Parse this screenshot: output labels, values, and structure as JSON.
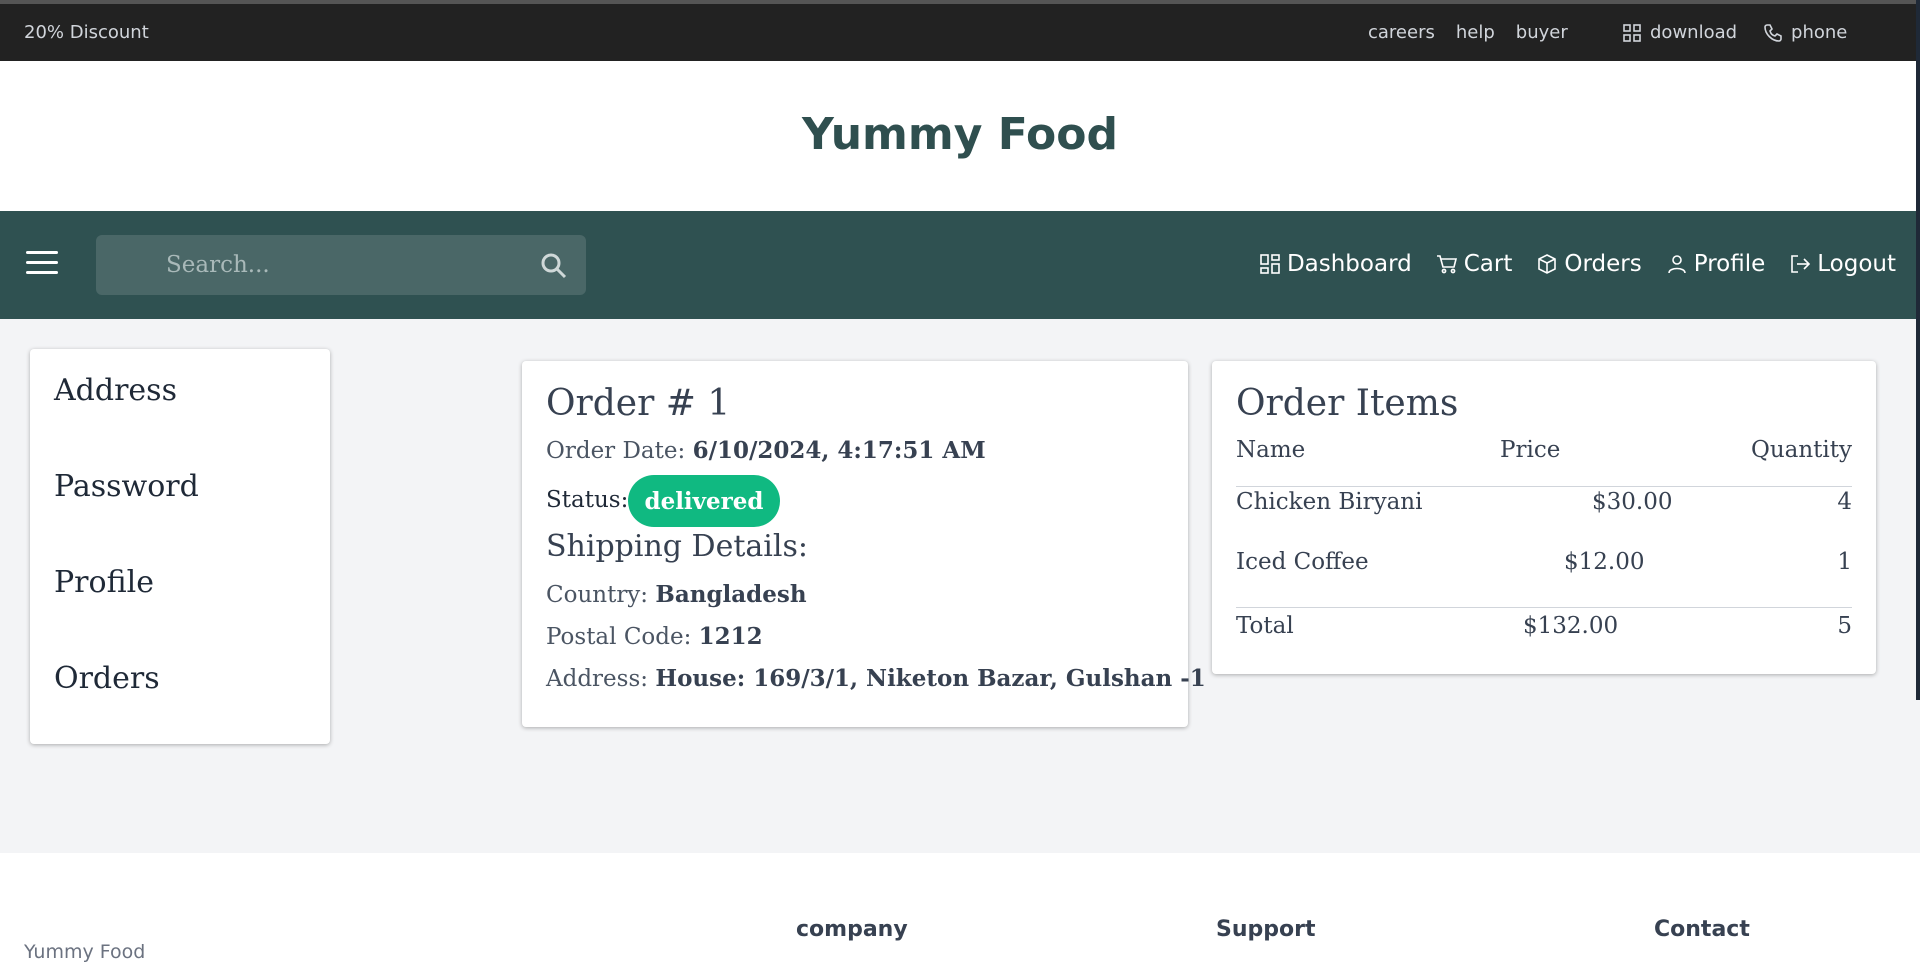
{
  "topbar": {
    "discount": "20% Discount",
    "links": [
      "careers",
      "help",
      "buyer"
    ],
    "download": "download",
    "phone": "phone"
  },
  "brand": {
    "title": "Yummy Food"
  },
  "navbar": {
    "search_placeholder": "Search...",
    "dashboard": "Dashboard",
    "cart": "Cart",
    "orders": "Orders",
    "profile": "Profile",
    "logout": "Logout"
  },
  "sidebar": {
    "items": [
      "Address",
      "Password",
      "Profile",
      "Orders"
    ]
  },
  "order": {
    "title": "Order # 1",
    "date_label": "Order Date: ",
    "date_value": "6/10/2024, 4:17:51 AM",
    "status_label": "Status:",
    "status_value": "delivered",
    "shipping_title": "Shipping Details:",
    "country_label": "Country: ",
    "country_value": "Bangladesh",
    "postal_label": "Postal Code: ",
    "postal_value": "1212",
    "address_label": "Address: ",
    "address_value": "House: 169/3/1, Niketon Bazar, Gulshan -1"
  },
  "order_items": {
    "title": "Order Items",
    "headers": [
      "Name",
      "Price",
      "Quantity"
    ],
    "rows": [
      {
        "name": "Chicken Biryani",
        "price": "$30.00",
        "qty": "4"
      },
      {
        "name": "Iced Coffee",
        "price": "$12.00",
        "qty": "1"
      }
    ],
    "total": {
      "label": "Total",
      "price": "$132.00",
      "qty": "5"
    }
  },
  "footer": {
    "brand": "Yummy Food",
    "columns": [
      "company",
      "Support",
      "Contact"
    ]
  },
  "colors": {
    "nav_bg": "#2f5151",
    "status_badge": "#10b981",
    "topbar_bg": "#222222"
  }
}
